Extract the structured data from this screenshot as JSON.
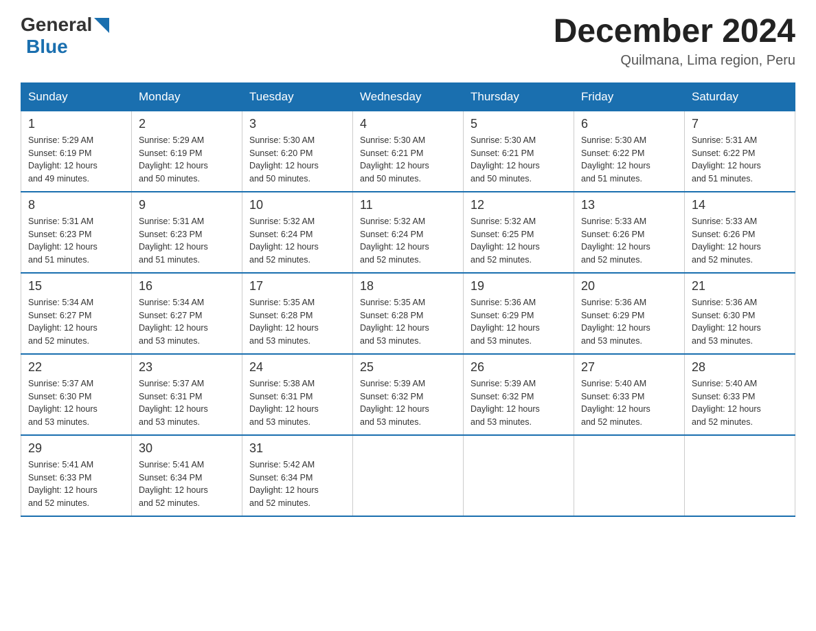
{
  "logo": {
    "text_general": "General",
    "text_blue": "Blue"
  },
  "header": {
    "month": "December 2024",
    "location": "Quilmana, Lima region, Peru"
  },
  "weekdays": [
    "Sunday",
    "Monday",
    "Tuesday",
    "Wednesday",
    "Thursday",
    "Friday",
    "Saturday"
  ],
  "weeks": [
    [
      {
        "day": "1",
        "sunrise": "5:29 AM",
        "sunset": "6:19 PM",
        "daylight": "12 hours and 49 minutes."
      },
      {
        "day": "2",
        "sunrise": "5:29 AM",
        "sunset": "6:19 PM",
        "daylight": "12 hours and 50 minutes."
      },
      {
        "day": "3",
        "sunrise": "5:30 AM",
        "sunset": "6:20 PM",
        "daylight": "12 hours and 50 minutes."
      },
      {
        "day": "4",
        "sunrise": "5:30 AM",
        "sunset": "6:21 PM",
        "daylight": "12 hours and 50 minutes."
      },
      {
        "day": "5",
        "sunrise": "5:30 AM",
        "sunset": "6:21 PM",
        "daylight": "12 hours and 50 minutes."
      },
      {
        "day": "6",
        "sunrise": "5:30 AM",
        "sunset": "6:22 PM",
        "daylight": "12 hours and 51 minutes."
      },
      {
        "day": "7",
        "sunrise": "5:31 AM",
        "sunset": "6:22 PM",
        "daylight": "12 hours and 51 minutes."
      }
    ],
    [
      {
        "day": "8",
        "sunrise": "5:31 AM",
        "sunset": "6:23 PM",
        "daylight": "12 hours and 51 minutes."
      },
      {
        "day": "9",
        "sunrise": "5:31 AM",
        "sunset": "6:23 PM",
        "daylight": "12 hours and 51 minutes."
      },
      {
        "day": "10",
        "sunrise": "5:32 AM",
        "sunset": "6:24 PM",
        "daylight": "12 hours and 52 minutes."
      },
      {
        "day": "11",
        "sunrise": "5:32 AM",
        "sunset": "6:24 PM",
        "daylight": "12 hours and 52 minutes."
      },
      {
        "day": "12",
        "sunrise": "5:32 AM",
        "sunset": "6:25 PM",
        "daylight": "12 hours and 52 minutes."
      },
      {
        "day": "13",
        "sunrise": "5:33 AM",
        "sunset": "6:26 PM",
        "daylight": "12 hours and 52 minutes."
      },
      {
        "day": "14",
        "sunrise": "5:33 AM",
        "sunset": "6:26 PM",
        "daylight": "12 hours and 52 minutes."
      }
    ],
    [
      {
        "day": "15",
        "sunrise": "5:34 AM",
        "sunset": "6:27 PM",
        "daylight": "12 hours and 52 minutes."
      },
      {
        "day": "16",
        "sunrise": "5:34 AM",
        "sunset": "6:27 PM",
        "daylight": "12 hours and 53 minutes."
      },
      {
        "day": "17",
        "sunrise": "5:35 AM",
        "sunset": "6:28 PM",
        "daylight": "12 hours and 53 minutes."
      },
      {
        "day": "18",
        "sunrise": "5:35 AM",
        "sunset": "6:28 PM",
        "daylight": "12 hours and 53 minutes."
      },
      {
        "day": "19",
        "sunrise": "5:36 AM",
        "sunset": "6:29 PM",
        "daylight": "12 hours and 53 minutes."
      },
      {
        "day": "20",
        "sunrise": "5:36 AM",
        "sunset": "6:29 PM",
        "daylight": "12 hours and 53 minutes."
      },
      {
        "day": "21",
        "sunrise": "5:36 AM",
        "sunset": "6:30 PM",
        "daylight": "12 hours and 53 minutes."
      }
    ],
    [
      {
        "day": "22",
        "sunrise": "5:37 AM",
        "sunset": "6:30 PM",
        "daylight": "12 hours and 53 minutes."
      },
      {
        "day": "23",
        "sunrise": "5:37 AM",
        "sunset": "6:31 PM",
        "daylight": "12 hours and 53 minutes."
      },
      {
        "day": "24",
        "sunrise": "5:38 AM",
        "sunset": "6:31 PM",
        "daylight": "12 hours and 53 minutes."
      },
      {
        "day": "25",
        "sunrise": "5:39 AM",
        "sunset": "6:32 PM",
        "daylight": "12 hours and 53 minutes."
      },
      {
        "day": "26",
        "sunrise": "5:39 AM",
        "sunset": "6:32 PM",
        "daylight": "12 hours and 53 minutes."
      },
      {
        "day": "27",
        "sunrise": "5:40 AM",
        "sunset": "6:33 PM",
        "daylight": "12 hours and 52 minutes."
      },
      {
        "day": "28",
        "sunrise": "5:40 AM",
        "sunset": "6:33 PM",
        "daylight": "12 hours and 52 minutes."
      }
    ],
    [
      {
        "day": "29",
        "sunrise": "5:41 AM",
        "sunset": "6:33 PM",
        "daylight": "12 hours and 52 minutes."
      },
      {
        "day": "30",
        "sunrise": "5:41 AM",
        "sunset": "6:34 PM",
        "daylight": "12 hours and 52 minutes."
      },
      {
        "day": "31",
        "sunrise": "5:42 AM",
        "sunset": "6:34 PM",
        "daylight": "12 hours and 52 minutes."
      },
      null,
      null,
      null,
      null
    ]
  ],
  "labels": {
    "sunrise": "Sunrise:",
    "sunset": "Sunset:",
    "daylight": "Daylight:"
  }
}
